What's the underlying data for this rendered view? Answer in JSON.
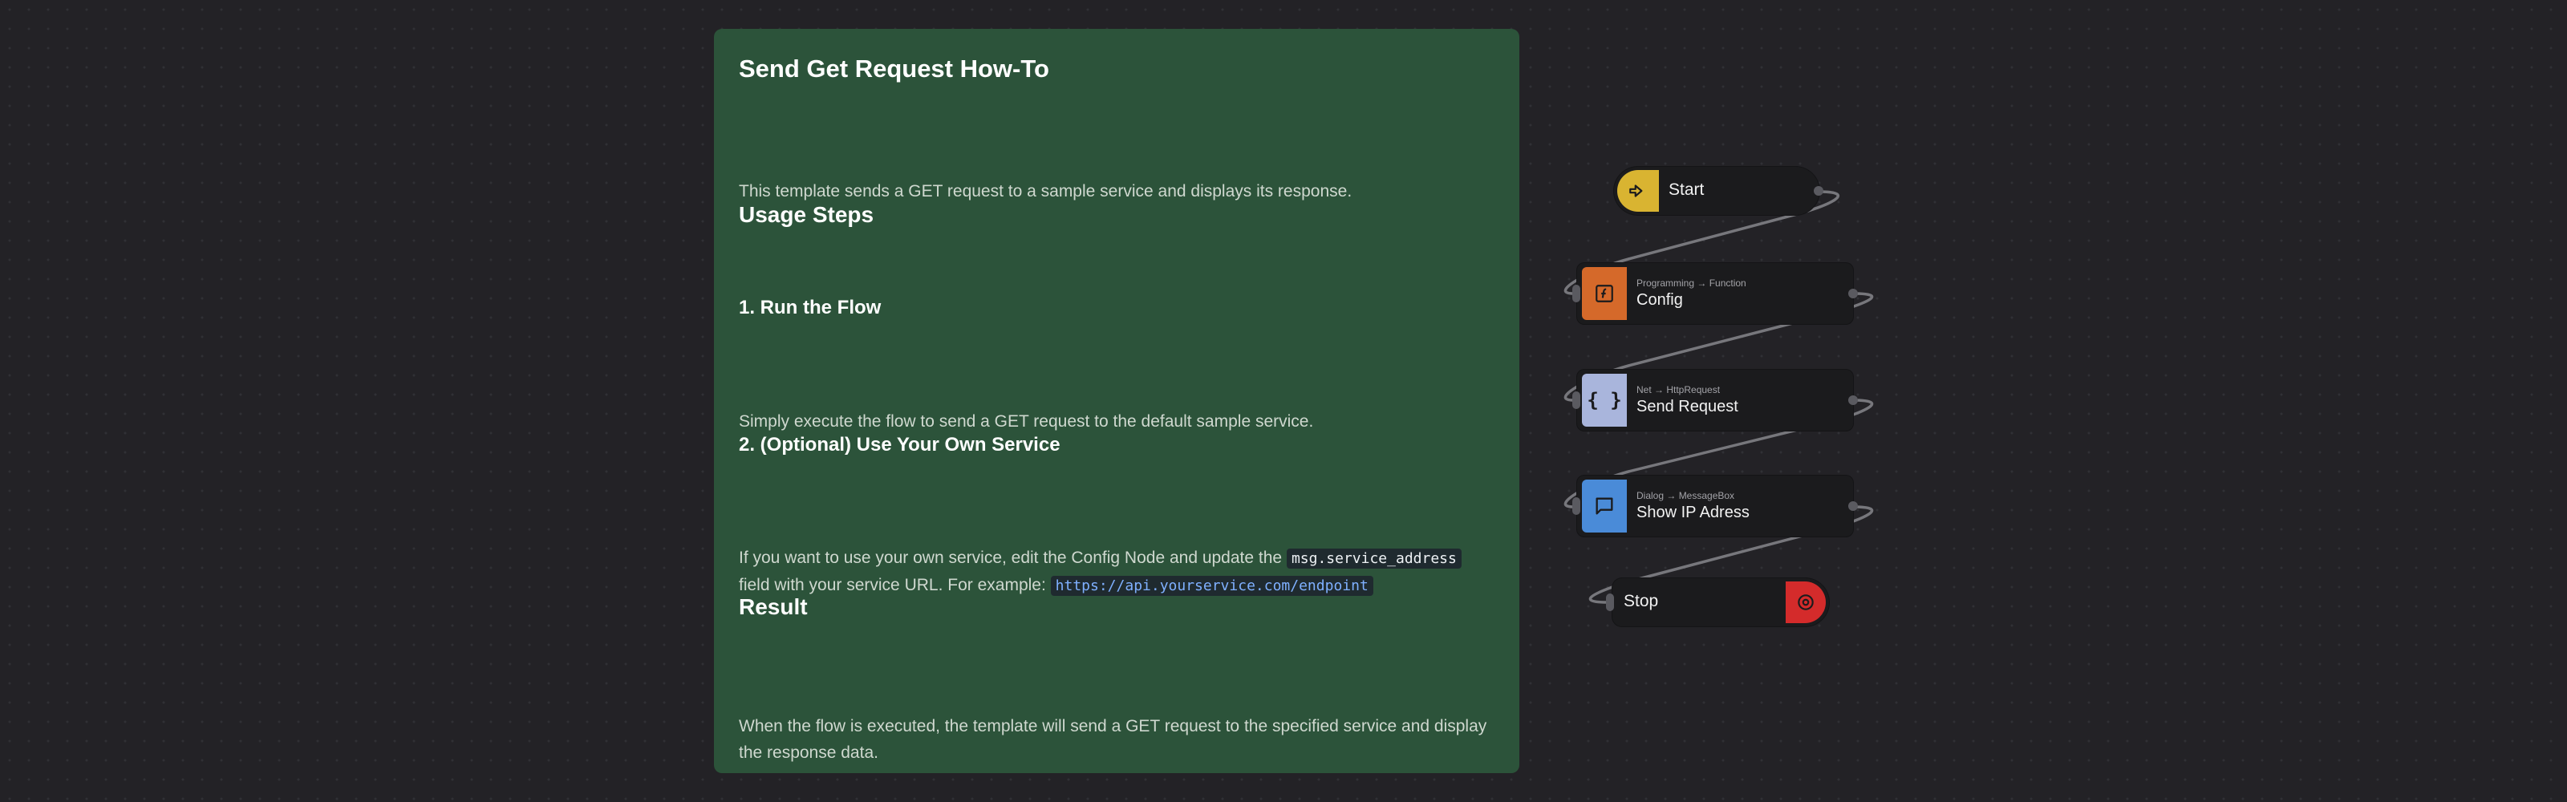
{
  "note": {
    "title": "Send Get Request How-To",
    "intro": "This template sends a GET request to a sample service and displays its response.",
    "usage_heading": "Usage Steps",
    "step1_heading": "1. Run the Flow",
    "step1_text": "Simply execute the flow to send a GET request to the default sample service.",
    "step2_heading": "2. (Optional) Use Your Own Service",
    "step2_text_a": "If you want to use your own service, edit the Config Node and update the",
    "step2_code": "msg.service_address",
    "step2_text_b": "field with your service URL. For example:",
    "step2_url": "https://api.yourservice.com/endpoint",
    "result_heading": "Result",
    "result_text": "When the flow is executed, the template will send a GET request to the specified service and display the response data."
  },
  "nodes": {
    "start": {
      "title": "Start",
      "icon": "enter-icon",
      "color": "#d9b431"
    },
    "config": {
      "category": "Programming → Function",
      "title": "Config",
      "icon": "function-icon",
      "color": "#d5692a"
    },
    "send": {
      "category": "Net → HttpRequest",
      "title": "Send Request",
      "icon": "braces-icon",
      "color": "#a9b5dc"
    },
    "show": {
      "category": "Dialog → MessageBox",
      "title": "Show IP Adress",
      "icon": "message-icon",
      "color": "#4a8bd8"
    },
    "stop": {
      "title": "Stop",
      "icon": "stop-icon",
      "color": "#d42b2b"
    }
  }
}
